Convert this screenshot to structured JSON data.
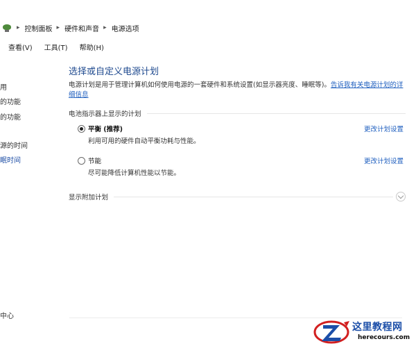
{
  "breadcrumb": {
    "items": [
      "控制面板",
      "硬件和声音",
      "电源选项"
    ],
    "separator": "▸"
  },
  "menu": {
    "items": [
      "查看(V)",
      "工具(T)",
      "帮助(H)"
    ]
  },
  "left_nav": {
    "items": [
      "用",
      "的功能",
      "的功能",
      "源的时间",
      "眠时间"
    ],
    "bottom": "中心"
  },
  "main": {
    "title": "选择或自定义电源计划",
    "description": "电源计划是用于管理计算机如何使用电源的一套硬件和系统设置(如显示器亮度、睡眠等)。",
    "description_link": "告诉我有关电源计划的详细信息",
    "section_battery": "电池指示器上显示的计划",
    "plans": [
      {
        "name": "平衡 (推荐)",
        "desc": "利用可用的硬件自动平衡功耗与性能。",
        "selected": true,
        "change_label": "更改计划设置"
      },
      {
        "name": "节能",
        "desc": "尽可能降低计算机性能以节能。",
        "selected": false,
        "change_label": "更改计划设置"
      }
    ],
    "section_more": "显示附加计划"
  },
  "watermark": {
    "title": "这里教程网",
    "url": "herecours.com"
  },
  "colors": {
    "link": "#1f5fbf",
    "title": "#1f4a8f",
    "watermark_blue": "#1b4ea8",
    "watermark_red": "#d22020"
  }
}
